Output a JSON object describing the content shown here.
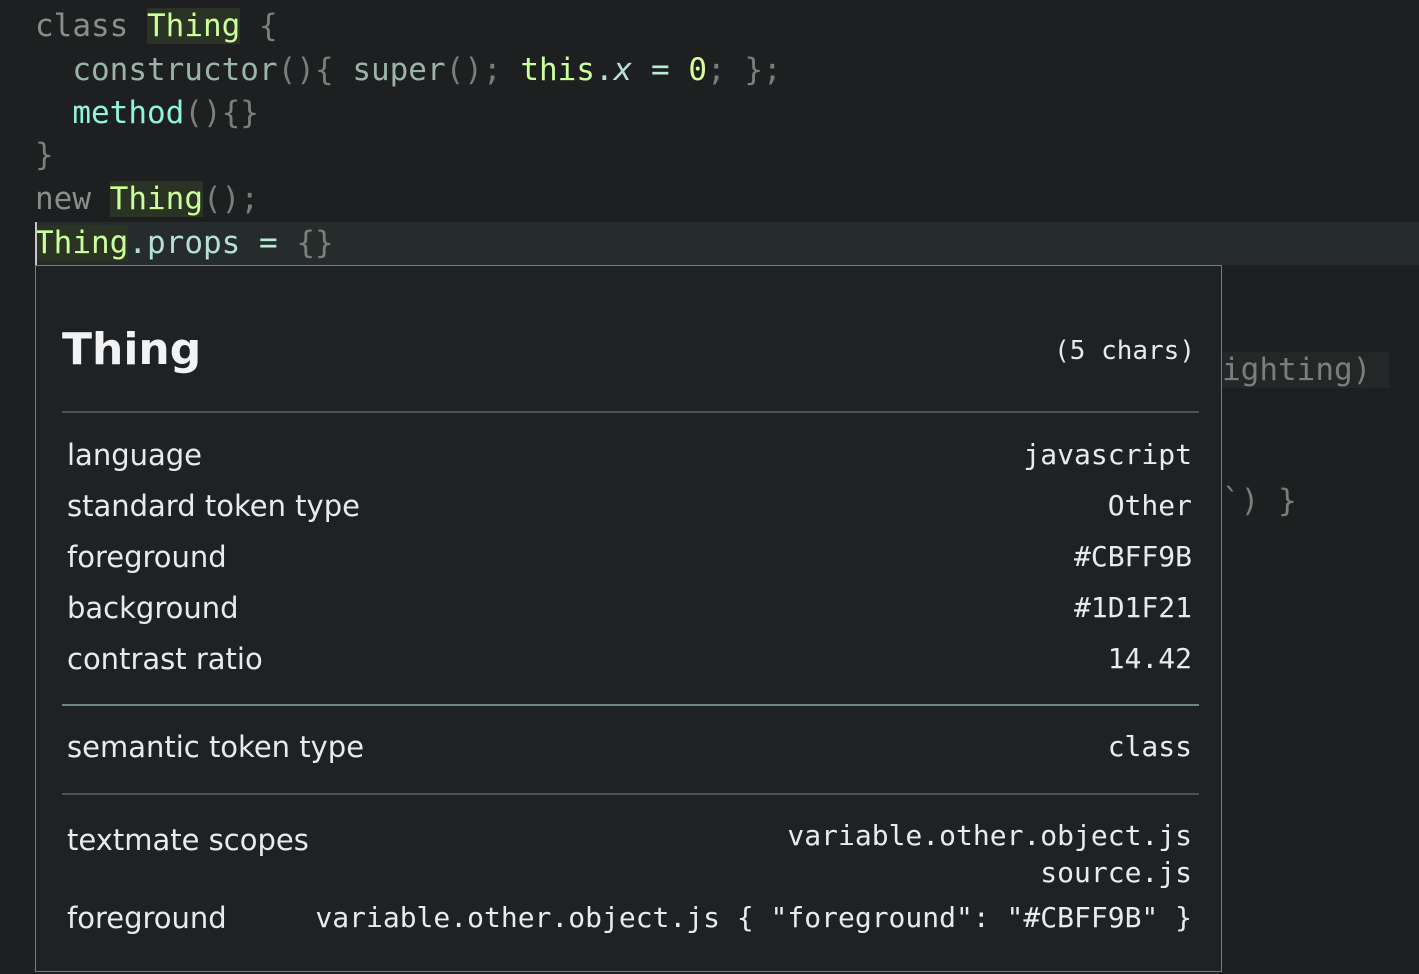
{
  "code": {
    "line1": {
      "kw": "class",
      "cls": "Thing",
      "brace": "{"
    },
    "line2": {
      "fn": "constructor",
      "p1": "(){",
      "sup": "super",
      "p2": "();",
      "this": "this",
      "dot": ".",
      "x": "x",
      "eq": "=",
      "zero": "0",
      "end": "; };"
    },
    "line3": {
      "meth": "method",
      "p": "(){}"
    },
    "line4": {
      "brace": "}"
    },
    "line5": {
      "kw": "new",
      "cls": "Thing",
      "p": "();"
    },
    "line6": {
      "cls": "Thing",
      "prop": ".props",
      "eq": "=",
      "obj": "{}"
    }
  },
  "background_fragments": {
    "frag1": "ighting)",
    "frag2": "`) }"
  },
  "hover": {
    "title": "Thing",
    "chars": "(5 chars)",
    "rows": [
      {
        "key": "language",
        "value": "javascript"
      },
      {
        "key": "standard token type",
        "value": "Other"
      },
      {
        "key": "foreground",
        "value": "#CBFF9B"
      },
      {
        "key": "background",
        "value": "#1D1F21"
      },
      {
        "key": "contrast ratio",
        "value": "14.42"
      }
    ],
    "semantic": {
      "key": "semantic token type",
      "value": "class"
    },
    "scopes": {
      "key": "textmate scopes",
      "value1": "variable.other.object.js",
      "value2": "source.js"
    },
    "fg_rule": {
      "key": "foreground",
      "value": "variable.other.object.js { \"foreground\": \"#CBFF9B\" }"
    }
  },
  "colors": {
    "editor_background": "#1D1F21",
    "token_foreground": "#CBFF9B"
  }
}
